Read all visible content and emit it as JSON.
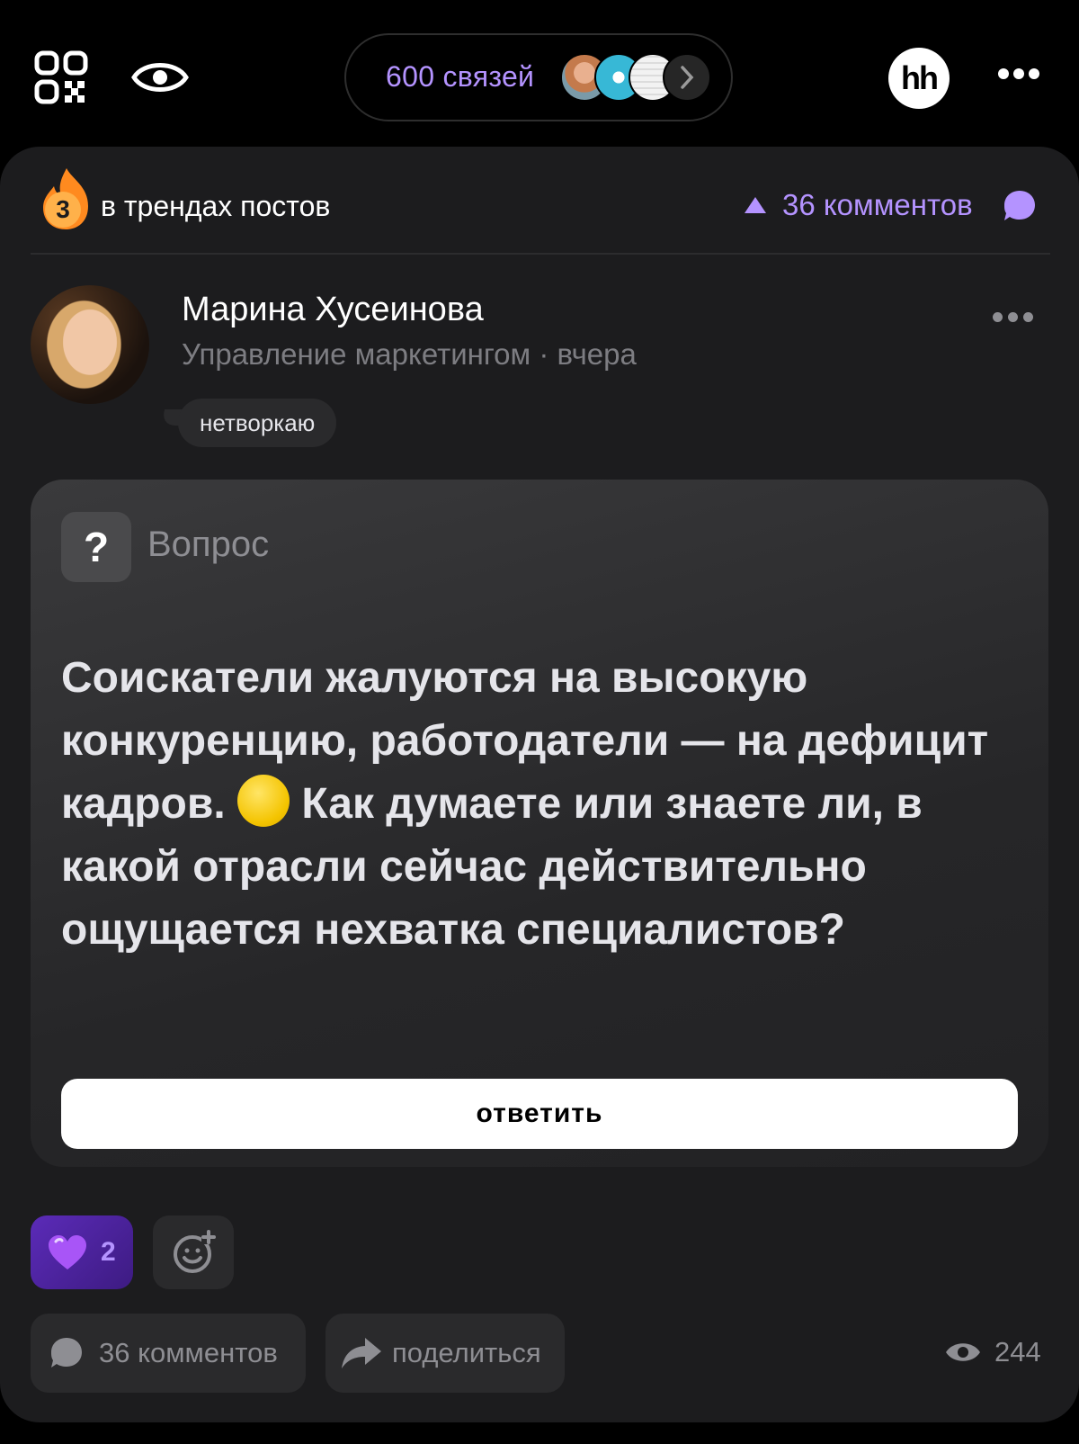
{
  "header": {
    "connections_label": "600 связей",
    "logo_text": "hh",
    "icons": [
      "qr-code-icon",
      "eye-icon",
      "chevron-right-icon",
      "more-icon"
    ]
  },
  "post": {
    "trend_rank": "3",
    "trend_text": "в трендах постов",
    "comments_top": "36 комментов",
    "author": {
      "name": "Марина Хусеинова",
      "meta": "Управление маркетингом · вчера",
      "status": "нетворкаю"
    },
    "question": {
      "label": "Вопрос",
      "icon_glyph": "?",
      "text_part1": "Соискатели жалуются на высокую конкуренцию, работодатели — на дефицит кадров.",
      "text_part2": "Как думаете или знаете ли, в какой отрасли сейчас действительно ощущается нехватка специалистов?",
      "answer_button": "ответить"
    },
    "reactions": {
      "heart_count": "2"
    },
    "actions": {
      "comments": "36 комментов",
      "share": "поделиться",
      "views": "244"
    }
  },
  "colors": {
    "accent": "#b493ff",
    "background": "#000000",
    "card": "#1c1c1e",
    "muted": "#8e8e93"
  }
}
